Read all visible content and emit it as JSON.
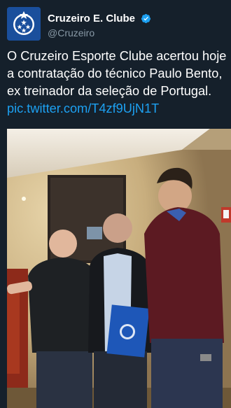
{
  "tweet": {
    "display_name": "Cruzeiro E. Clube",
    "handle": "@Cruzeiro",
    "text": "O Cruzeiro Esporte Clube acertou hoje a contratação do técnico Paulo Bento, ex treinador da seleção de Portugal.",
    "link": "pic.twitter.com/T4zf9UjN1T"
  },
  "colors": {
    "background": "#15202b",
    "link": "#1da1f2",
    "handle": "#8899a6",
    "avatar": "#1a4f9c",
    "verified": "#1da1f2"
  },
  "icons": {
    "avatar": "cruzeiro-crest-icon",
    "verified": "verified-badge-icon"
  }
}
